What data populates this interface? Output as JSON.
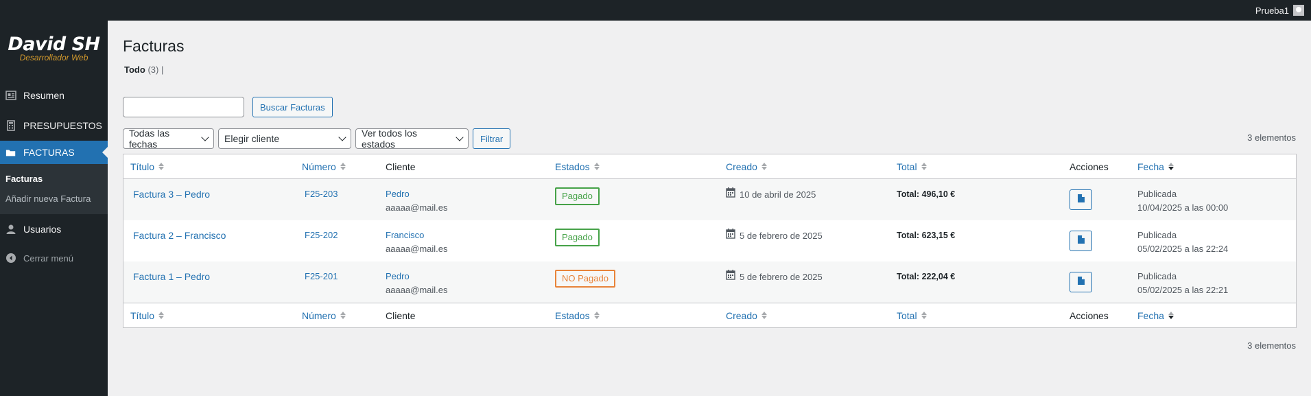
{
  "adminbar": {
    "user_name": "Prueba1"
  },
  "logo": {
    "line1": "David SH",
    "line2": "Desarrollador Web"
  },
  "sidebar": {
    "items": [
      {
        "label": "Resumen",
        "icon": "dashboard-icon"
      },
      {
        "label": "PRESUPUESTOS",
        "icon": "calculator-icon"
      },
      {
        "label": "FACTURAS",
        "icon": "folder-icon"
      },
      {
        "label": "Usuarios",
        "icon": "user-icon"
      },
      {
        "label": "Cerrar menú",
        "icon": "collapse-icon"
      }
    ],
    "submenu": [
      "Facturas",
      "Añadir nueva Factura"
    ]
  },
  "page": {
    "title": "Facturas",
    "views": {
      "all_label": "Todo",
      "all_count": "(3)",
      "separator": "|"
    },
    "search_button": "Buscar Facturas",
    "filters": {
      "dates": "Todas las fechas",
      "client": "Elegir cliente",
      "status": "Ver todos los estados",
      "filter_button": "Filtrar"
    },
    "count": "3 elementos"
  },
  "table": {
    "headers": {
      "titulo": "Título",
      "numero": "Número",
      "cliente": "Cliente",
      "estados": "Estados",
      "creado": "Creado",
      "total": "Total",
      "acciones": "Acciones",
      "fecha": "Fecha"
    },
    "rows": [
      {
        "titulo": "Factura 3 – Pedro",
        "numero": "F25-203",
        "cliente": "Pedro",
        "email": "aaaaa@mail.es",
        "estado": "Pagado",
        "estado_type": "paid",
        "creado": "10 de abril de 2025",
        "total": "Total: 496,10 €",
        "fecha_status": "Publicada",
        "fecha": "10/04/2025 a las 00:00"
      },
      {
        "titulo": "Factura 2 – Francisco",
        "numero": "F25-202",
        "cliente": "Francisco",
        "email": "aaaaa@mail.es",
        "estado": "Pagado",
        "estado_type": "paid",
        "creado": "5 de febrero de 2025",
        "total": "Total: 623,15 €",
        "fecha_status": "Publicada",
        "fecha": "05/02/2025 a las 22:24"
      },
      {
        "titulo": "Factura 1 – Pedro",
        "numero": "F25-201",
        "cliente": "Pedro",
        "email": "aaaaa@mail.es",
        "estado": "NO Pagado",
        "estado_type": "unpaid",
        "creado": "5 de febrero de 2025",
        "total": "Total: 222,04 €",
        "fecha_status": "Publicada",
        "fecha": "05/02/2025 a las 22:21"
      }
    ]
  },
  "colors": {
    "accent": "#2271b1",
    "sidebar": "#1d2327",
    "paid": "#46a248",
    "unpaid": "#e8833a"
  }
}
